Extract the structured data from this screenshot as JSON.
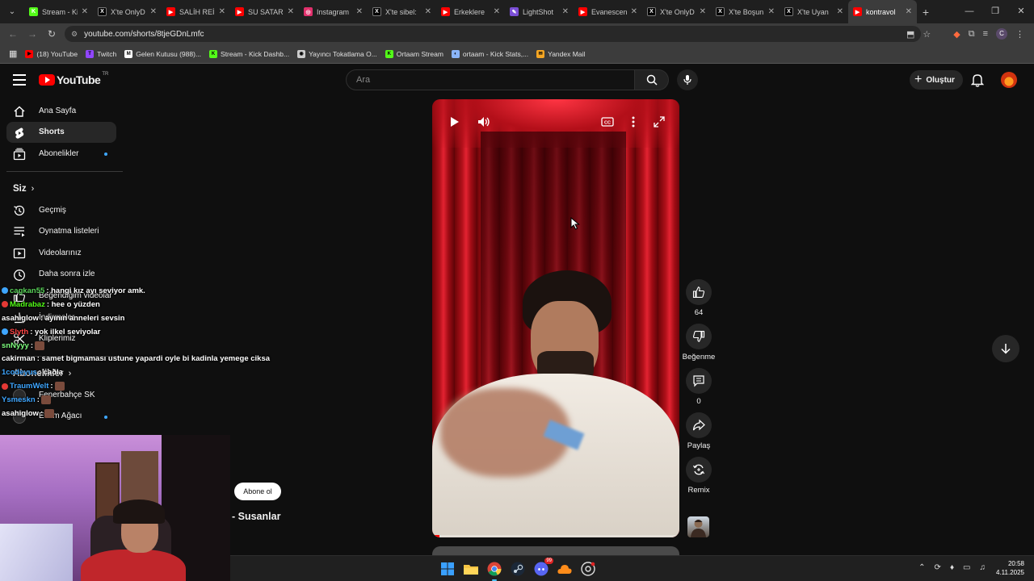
{
  "browser": {
    "tabs": [
      {
        "label": "Stream - Ki",
        "favicon": "K",
        "favicon_color": "#53fc18"
      },
      {
        "label": "X'te OnlyD",
        "favicon": "X",
        "favicon_color": "#000000"
      },
      {
        "label": "SALİH REİ",
        "favicon": "▶",
        "favicon_color": "#ff0000"
      },
      {
        "label": "SU SATAR",
        "favicon": "▶",
        "favicon_color": "#ff0000"
      },
      {
        "label": "Instagram",
        "favicon": "◎",
        "favicon_color": "#e1306c"
      },
      {
        "label": "X'te sibel:",
        "favicon": "X",
        "favicon_color": "#000000"
      },
      {
        "label": "Erkeklere",
        "favicon": "▶",
        "favicon_color": "#ff0000"
      },
      {
        "label": "LightShot",
        "favicon": "✎",
        "favicon_color": "#7b4fd6"
      },
      {
        "label": "Evanescen",
        "favicon": "▶",
        "favicon_color": "#ff0000"
      },
      {
        "label": "X'te OnlyD",
        "favicon": "X",
        "favicon_color": "#000000"
      },
      {
        "label": "X'te Boşun",
        "favicon": "X",
        "favicon_color": "#000000"
      },
      {
        "label": "X'te Uyan",
        "favicon": "X",
        "favicon_color": "#000000"
      },
      {
        "label": "kontravol",
        "favicon": "▶",
        "favicon_color": "#ff0000"
      }
    ],
    "url": "youtube.com/shorts/8tjeGDnLmfc",
    "profile_initial": "C",
    "bookmarks": [
      {
        "label": "(18) YouTube",
        "icon": "▶",
        "color": "#ff0000"
      },
      {
        "label": "Twitch",
        "icon": "T",
        "color": "#9146ff"
      },
      {
        "label": "Gelen Kutusu (988)...",
        "icon": "M",
        "color": "#ffffff"
      },
      {
        "label": "Stream - Kick Dashb...",
        "icon": "K",
        "color": "#53fc18"
      },
      {
        "label": "Yayıncı Tokatlama O...",
        "icon": "◉",
        "color": "#cccccc"
      },
      {
        "label": "Ortaam Stream",
        "icon": "K",
        "color": "#53fc18"
      },
      {
        "label": "ortaam - Kick Stats,...",
        "icon": "◐",
        "color": "#8ab4f8"
      },
      {
        "label": "Yandex Mail",
        "icon": "✉",
        "color": "#f5a623"
      }
    ]
  },
  "youtube": {
    "logo_text": "YouTube",
    "region": "TR",
    "search_placeholder": "Ara",
    "create_label": "Oluştur",
    "sidebar": {
      "main": [
        {
          "label": "Ana Sayfa",
          "icon": "home-icon"
        },
        {
          "label": "Shorts",
          "icon": "shorts-icon",
          "active": true
        },
        {
          "label": "Abonelikler",
          "icon": "subscriptions-icon",
          "dot": true
        }
      ],
      "you_section": "Siz",
      "you_items": [
        {
          "label": "Geçmiş",
          "icon": "history-icon"
        },
        {
          "label": "Oynatma listeleri",
          "icon": "playlists-icon"
        },
        {
          "label": "Videolarınız",
          "icon": "your-videos-icon"
        },
        {
          "label": "Daha sonra izle",
          "icon": "watch-later-icon"
        },
        {
          "label": "Beğendiğim videolar",
          "icon": "liked-icon"
        },
        {
          "label": "İndirmeler",
          "icon": "downloads-icon"
        },
        {
          "label": "Kliplerimiz",
          "icon": "clips-icon"
        }
      ],
      "subs_section": "Abonelikler",
      "subs_items": [
        {
          "label": "Fenerbahçe SK"
        },
        {
          "label": "Evrim Ağacı",
          "dot": true
        }
      ]
    },
    "short": {
      "likes": "64",
      "dislike_label": "Beğenme",
      "comments": "0",
      "share_label": "Paylaş",
      "remix_label": "Remix",
      "subscribe_label": "Abone ol",
      "channel_name": "- Susanlar",
      "progress_fraction": 0.03
    }
  },
  "chat": [
    {
      "user": "cagkan55",
      "user_color": "#5ad35a",
      "message": ": hangi kız ayı seviyor amk."
    },
    {
      "user": "Madrabaz",
      "user_color": "#53fc18",
      "message": ": hee o yüzden"
    },
    {
      "user": "asahiglow",
      "user_color": "#ffffff",
      "message": ": ayının anneleri sevsin"
    },
    {
      "user": "Slyth",
      "user_color": "#ff4545",
      "message": ": yok ilkel seviyolar"
    },
    {
      "user": "snNyyy",
      "user_color": "#7fff7f",
      "message": ":",
      "emote": true
    },
    {
      "user": "cakirman",
      "user_color": "#ffffff",
      "message": ": samet bigmaması ustune yapardi oyle bi kadinla yemege ciksa"
    },
    {
      "user": "1codeyus",
      "user_color": "#3ea6ff",
      "message": ": caðla"
    },
    {
      "user": "TraumWelt",
      "user_color": "#3ea6ff",
      "message": ":",
      "emote": true
    },
    {
      "user": "Ysmeskn",
      "user_color": "#3ea6ff",
      "message": ":",
      "emote": true
    },
    {
      "user": "asahiglow",
      "user_color": "#ffffff",
      "message": ":",
      "emote": true
    }
  ],
  "taskbar": {
    "time": "20:58",
    "date": "4.11.2025",
    "discord_badge": "99"
  }
}
